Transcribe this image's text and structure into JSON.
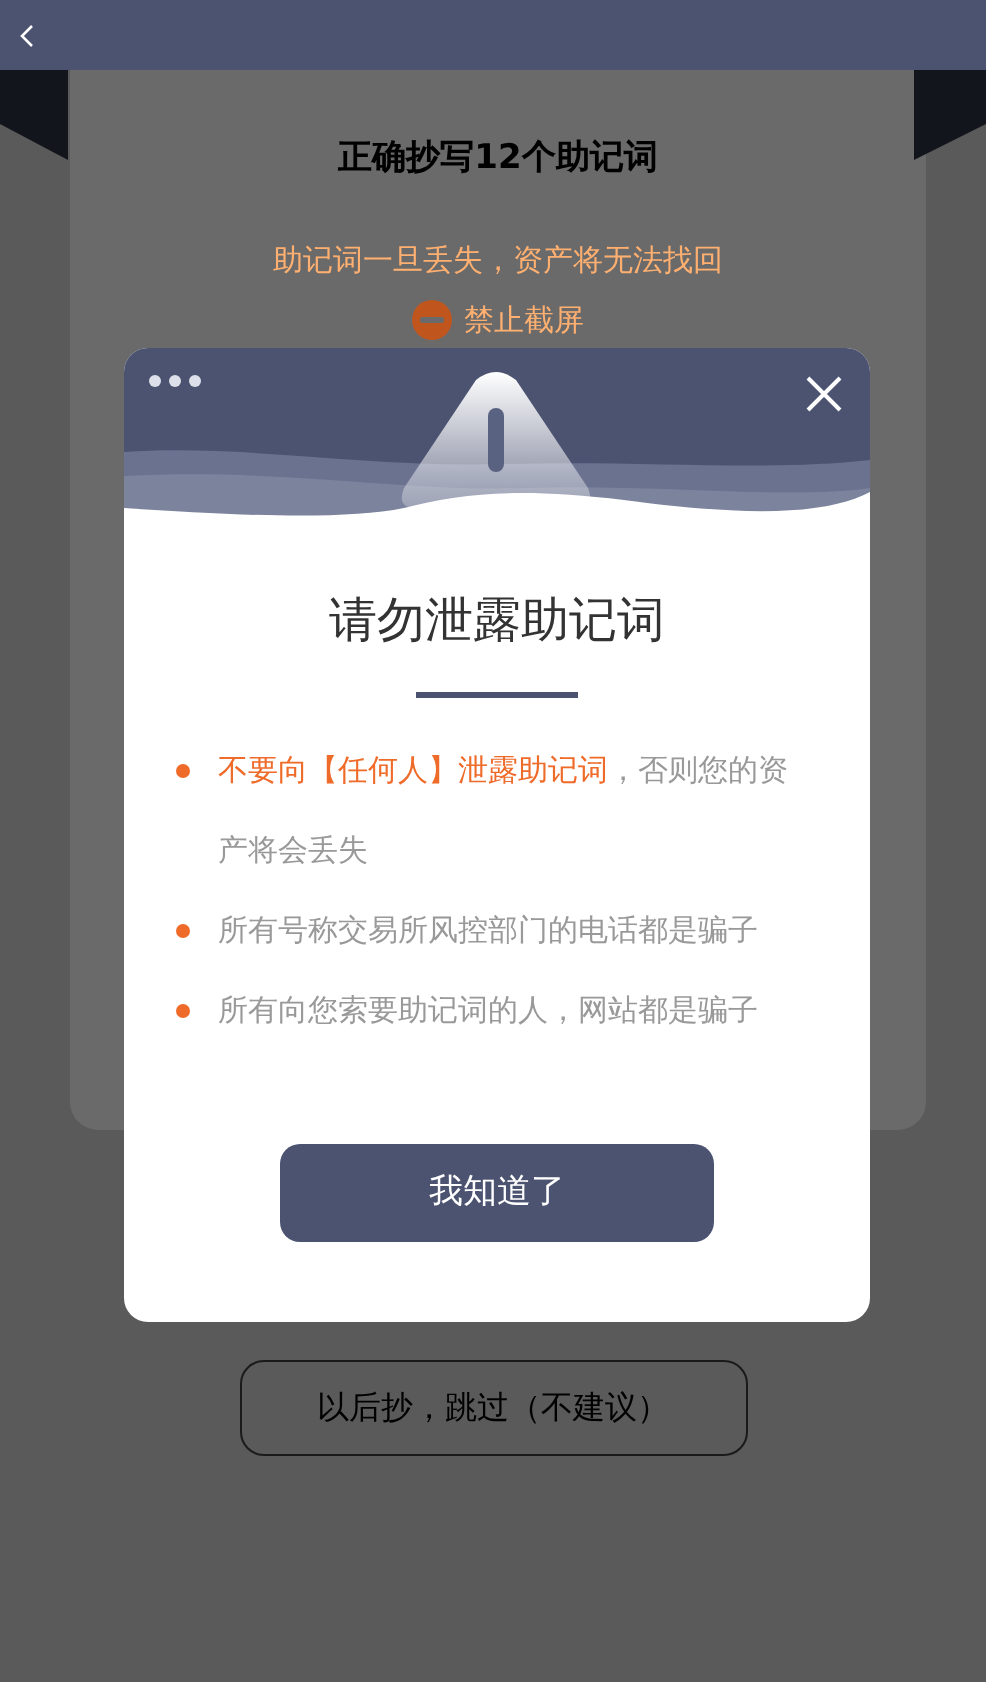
{
  "page": {
    "title": "正确抄写12个助记词",
    "warning": "助记词一旦丢失，资产将无法找回",
    "notice": "禁止截屏",
    "skip_button": "以后抄，跳过（不建议）"
  },
  "modal": {
    "title": "请勿泄露助记词",
    "items": [
      {
        "highlight": "不要向【任何人】泄露助记词",
        "text": "，否则您的资产将会丢失"
      },
      {
        "text": "所有号称交易所风控部门的电话都是骗子"
      },
      {
        "text": "所有向您索要助记词的人，网站都是骗子"
      }
    ],
    "confirm_button": "我知道了"
  }
}
